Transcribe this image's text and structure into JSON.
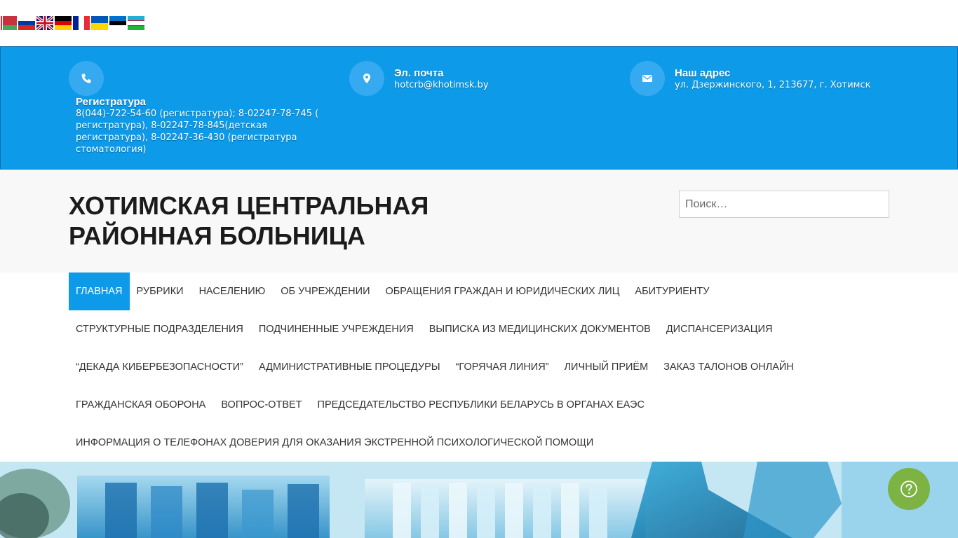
{
  "languages": [
    {
      "code": "be",
      "icon": "flag-belarus-icon"
    },
    {
      "code": "ru",
      "icon": "flag-russia-icon"
    },
    {
      "code": "en",
      "icon": "flag-uk-icon"
    },
    {
      "code": "de",
      "icon": "flag-germany-icon"
    },
    {
      "code": "fr",
      "icon": "flag-france-icon"
    },
    {
      "code": "uk",
      "icon": "flag-ukraine-icon"
    },
    {
      "code": "et",
      "icon": "flag-estonia-icon"
    },
    {
      "code": "uz",
      "icon": "flag-uzbekistan-icon"
    }
  ],
  "contacts": {
    "phone": {
      "title": "Регистратура",
      "text": "8(044)-722-54-60 (регистратура); 8-02247-78-745 ( регистратура), 8-02247-78-845(детская регистратура), 8-02247-36-430 (регистратура стоматология)",
      "icon": "phone-icon"
    },
    "email": {
      "title": "Эл. почта",
      "text": "hotcrb@khotimsk.by",
      "icon": "map-marker-icon"
    },
    "address": {
      "title": "Наш адрес",
      "text": "ул. Дзержинского, 1, 213677, г. Хотимск",
      "icon": "envelope-icon"
    }
  },
  "site": {
    "title": "Хотимская центральная районная больница"
  },
  "search": {
    "placeholder": "Поиск…"
  },
  "nav": {
    "rows": [
      [
        "Главная",
        "Рубрики",
        "Населению",
        "Об учреждении",
        "Обращения граждан и юридических лиц",
        "Абитуриенту"
      ],
      [
        "Структурные подразделения",
        "Подчиненные учреждения",
        "Выписка из медицинских документов",
        "Диспансеризация"
      ],
      [
        "“Декада кибербезопасности”",
        "Административные процедуры",
        "“Горячая линия”",
        "Личный приём",
        "Заказ талонов онлайн"
      ],
      [
        "Гражданская оборона",
        "Вопрос-ответ",
        "Председательство Республики Беларусь в органах ЕАЭС"
      ],
      [
        "Информация о телефонах доверия для оказания экстренной психологической помощи"
      ]
    ]
  },
  "colors": {
    "accent": "#0d9ae8",
    "help_button": "#7cb342"
  },
  "help": {
    "icon": "question-circle-icon"
  }
}
